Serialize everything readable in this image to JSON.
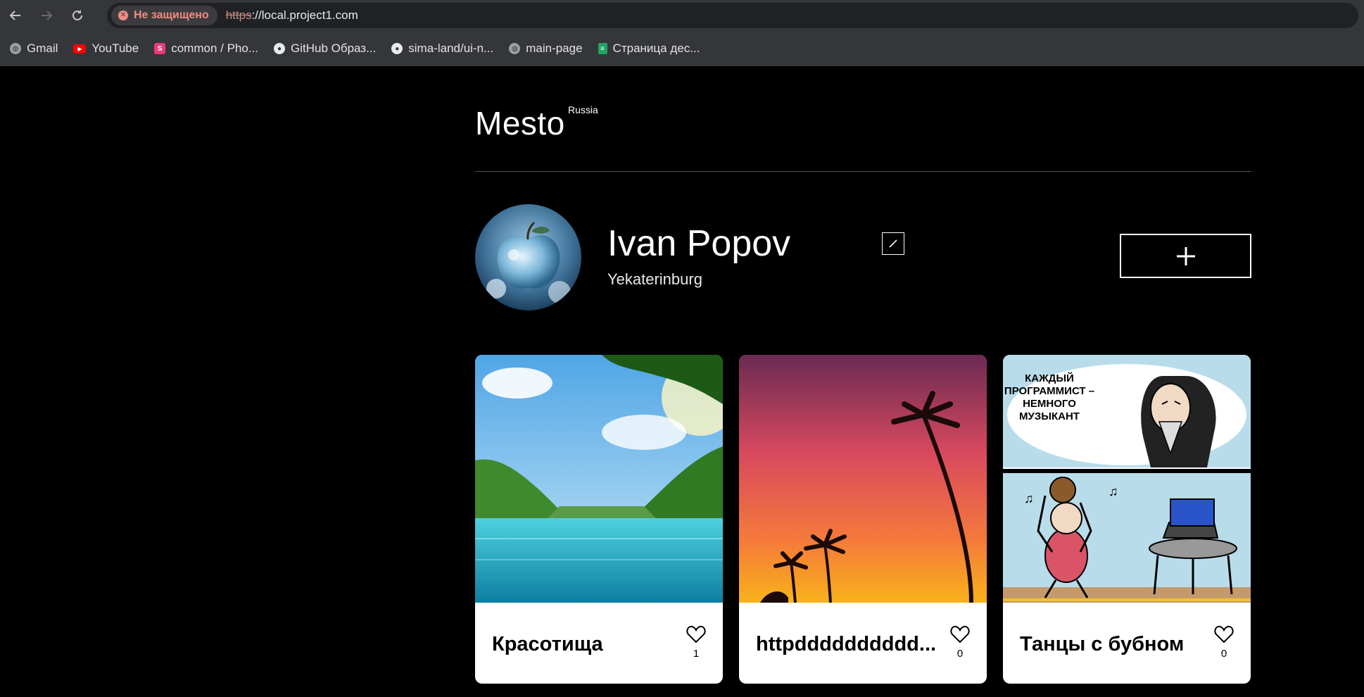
{
  "browser": {
    "insecure_label": "Не защищено",
    "url_scheme": "https",
    "url_rest": "://local.project1.com",
    "bookmarks": [
      {
        "label": "Gmail",
        "icon": "globe-icon"
      },
      {
        "label": "YouTube",
        "icon": "youtube-icon"
      },
      {
        "label": "common / Pho...",
        "icon": "sima-icon"
      },
      {
        "label": "GitHub Образ...",
        "icon": "github-icon"
      },
      {
        "label": "sima-land/ui-n...",
        "icon": "github-icon"
      },
      {
        "label": "main-page",
        "icon": "globe-icon"
      },
      {
        "label": "Страница дес...",
        "icon": "doc-icon"
      }
    ]
  },
  "header": {
    "logo": "Mesto",
    "logo_sup": "Russia"
  },
  "profile": {
    "name": "Ivan Popov",
    "job": "Yekaterinburg"
  },
  "cards": [
    {
      "title": "Красотища",
      "likes": "1",
      "image": "lake-landscape"
    },
    {
      "title": "httpdddddddddd...",
      "likes": "0",
      "image": "sunset-palms"
    },
    {
      "title": "Танцы с бубном",
      "likes": "0",
      "image": "comic-programmer",
      "comic_text": [
        "КАЖДЫЙ",
        "ПРОГРАММИСТ –",
        "НЕМНОГО",
        "МУЗЫКАНТ"
      ]
    }
  ]
}
